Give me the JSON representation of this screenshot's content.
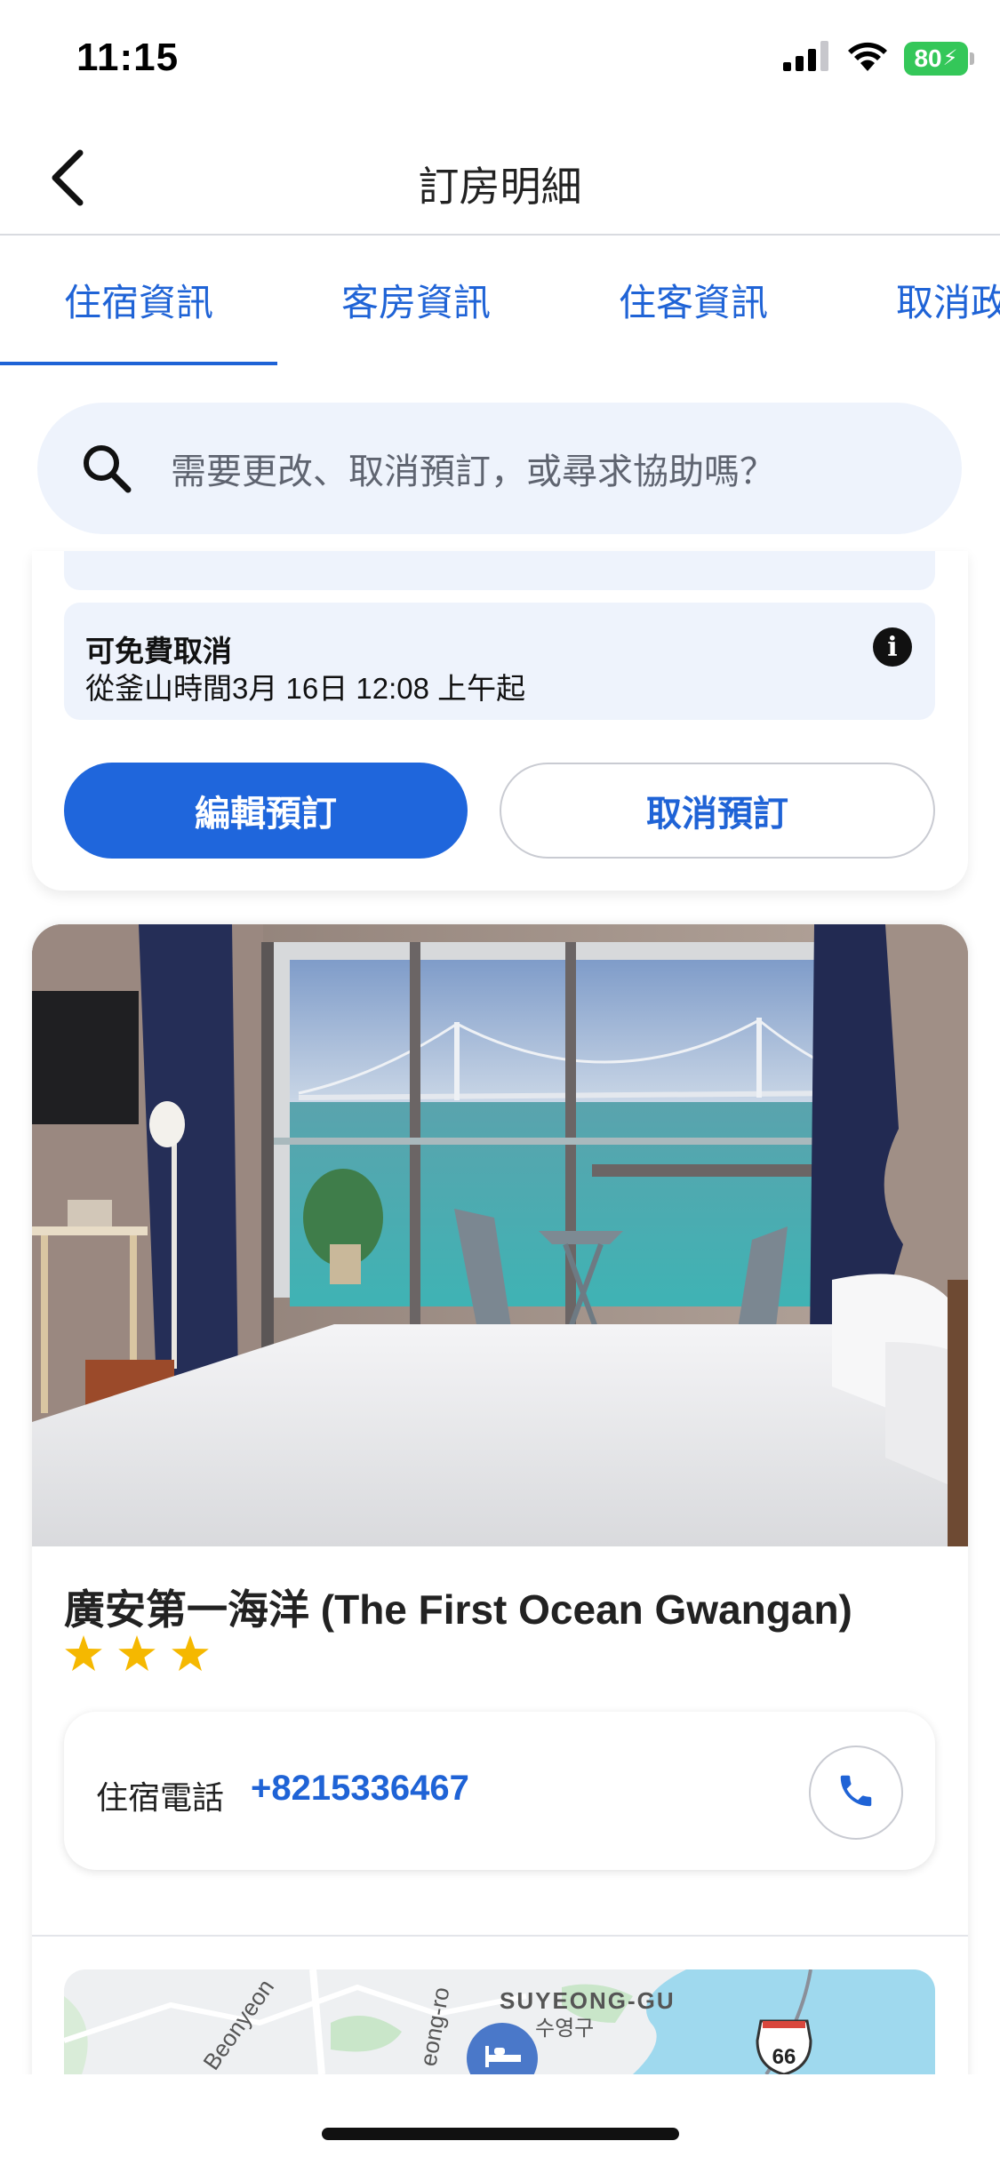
{
  "status_bar": {
    "time": "11:15",
    "battery": "80",
    "battery_color": "#34c759"
  },
  "header": {
    "title": "訂房明細",
    "back_icon": "chevron-left-icon"
  },
  "tabs": [
    {
      "label": "住宿資訊",
      "active": true
    },
    {
      "label": "客房資訊",
      "active": false
    },
    {
      "label": "住客資訊",
      "active": false
    },
    {
      "label": "取消政策",
      "active": false
    }
  ],
  "search": {
    "placeholder": "需要更改、取消預訂，或尋求協助嗎？",
    "icon": "search-icon"
  },
  "booking": {
    "cancellation_title": "可免費取消",
    "cancellation_detail": "從釜山時間3月 16日 12:08 上午起",
    "info_icon": "info-icon",
    "edit_button": "編輯預訂",
    "cancel_button": "取消預訂"
  },
  "hotel": {
    "name": "廣安第一海洋 (The First Ocean Gwangan)",
    "star_rating": 3,
    "phone_label": "住宿電話",
    "phone_number": "+8215336467",
    "phone_icon": "phone-icon"
  },
  "map": {
    "district_en": "SUYEONG-GU",
    "district_ko": "수영구",
    "road_left": "Beonyeon",
    "road_mid": "eong-ro",
    "route_number": "66",
    "marker_icon": "bed-icon"
  },
  "colors": {
    "accent": "#1f63d6",
    "button_primary": "#1f66dc",
    "info_background": "#eef3fc",
    "star": "#f5b800"
  }
}
